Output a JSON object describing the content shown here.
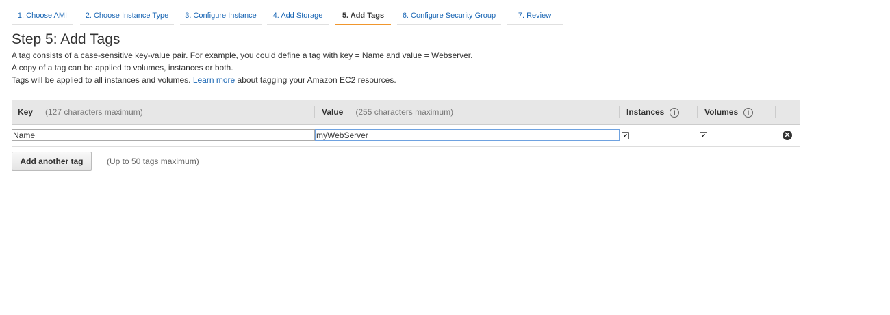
{
  "wizard": {
    "steps": [
      "1. Choose AMI",
      "2. Choose Instance Type",
      "3. Configure Instance",
      "4. Add Storage",
      "5. Add Tags",
      "6. Configure Security Group",
      "7. Review"
    ],
    "active_step": "5. Add Tags"
  },
  "page": {
    "title": "Step 5: Add Tags",
    "line1": "A tag consists of a case-sensitive key-value pair. For example, you could define a tag with key = Name and value = Webserver.",
    "line2": "A copy of a tag can be applied to volumes, instances or both.",
    "line3_before": "Tags will be applied to all instances and volumes.",
    "line3_link": "Learn more",
    "line3_after": "about tagging your Amazon EC2 resources."
  },
  "table": {
    "headers": {
      "key": "Key",
      "key_hint": "(127 characters maximum)",
      "value": "Value",
      "value_hint": "(255 characters maximum)",
      "instances": "Instances",
      "volumes": "Volumes"
    },
    "rows": [
      {
        "key": "Name",
        "value": "myWebServer",
        "instances": true,
        "volumes": true
      }
    ]
  },
  "actions": {
    "add_tag": "Add another tag",
    "limit_note": "(Up to 50 tags maximum)"
  },
  "colors": {
    "link": "#1a66b4",
    "active_tab_underline": "#f0962d",
    "header_bg": "#e7e7e7"
  },
  "icons": {
    "info": "info-circle-icon",
    "remove": "remove-x-icon",
    "check": "checkmark"
  }
}
